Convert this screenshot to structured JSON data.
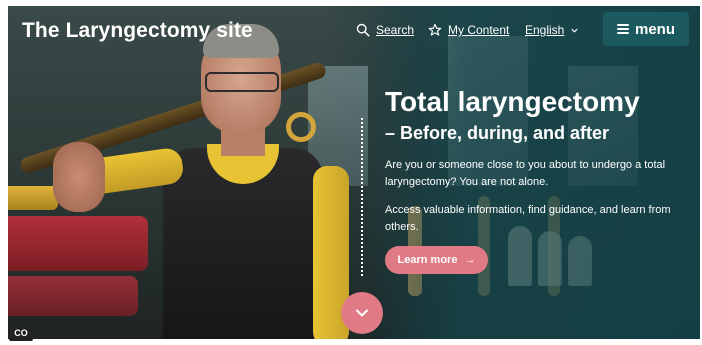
{
  "header": {
    "site_title": "The Laryngectomy site",
    "search_label": "Search",
    "my_content_label": "My Content",
    "language_label": "English",
    "menu_label": "menu"
  },
  "hero": {
    "title": "Total laryngectomy",
    "subtitle": "– Before, during, and after",
    "paragraph_1": "Are you or someone close to you about to undergo a total laryngectomy? You are not alone.",
    "paragraph_2": "Access valuable information, find guidance, and learn from others.",
    "cta_label": "Learn more",
    "cta_arrow": "→"
  },
  "badge": {
    "label": "CO"
  },
  "icons": {
    "search": "search-icon",
    "my_content": "star-icon",
    "language_dropdown": "chevron-down-icon",
    "menu": "hamburger-icon",
    "scroll_down": "chevron-down-icon",
    "cta_arrow": "arrow-right-icon"
  },
  "colors": {
    "accent_pink": "#e07b86",
    "menu_teal": "#1d5a60",
    "text_white": "#ffffff"
  }
}
